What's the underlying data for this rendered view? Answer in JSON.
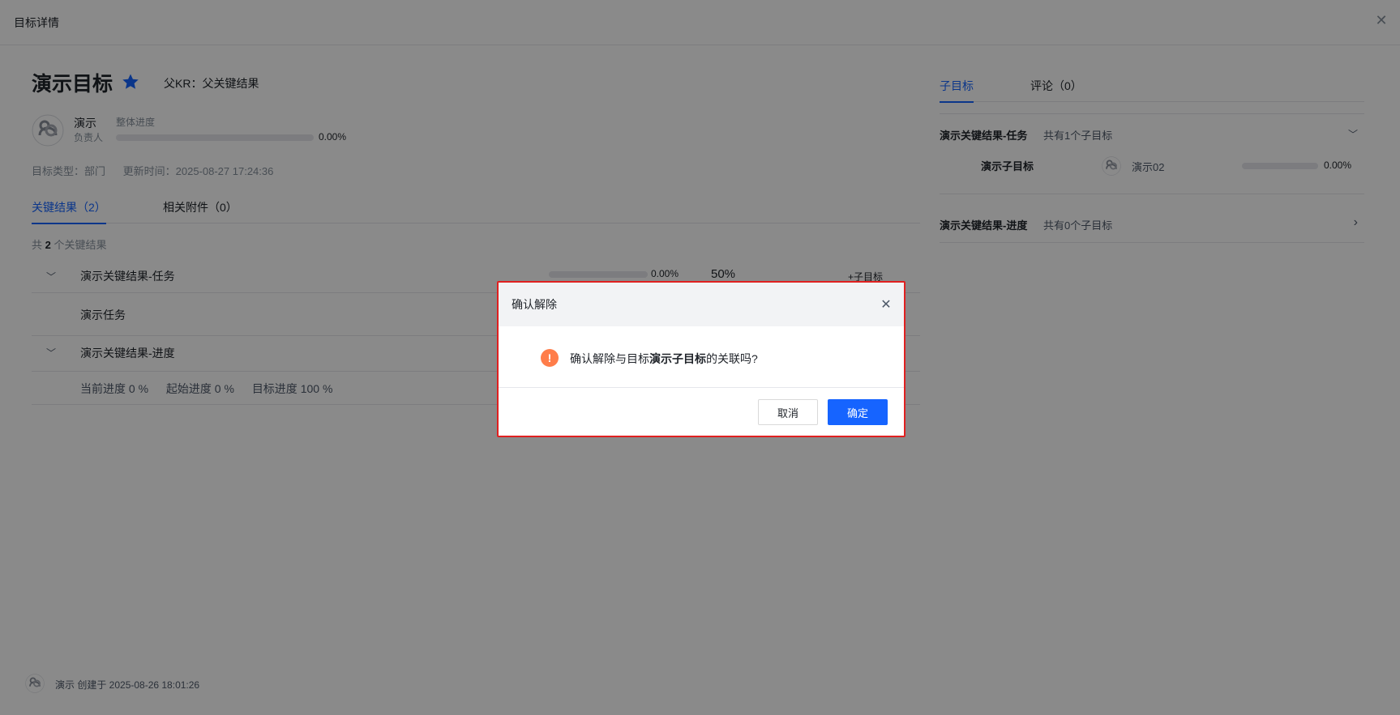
{
  "panel": {
    "title": "目标详情"
  },
  "goal": {
    "title": "演示目标",
    "parent_kr": "父KR：父关键结果",
    "owner_name": "演示",
    "owner_role": "负责人",
    "overall_progress_label": "整体进度",
    "overall_progress_value": "0.00%",
    "overall_progress": 0,
    "type_label": "目标类型：部门",
    "updated_label": "更新时间：2025-08-27 17:24:36"
  },
  "tabs": [
    "关键结果（2）",
    "相关附件（0）"
  ],
  "kr_count": {
    "prefix": "共",
    "count": "2",
    "suffix": "个关键结果"
  },
  "key_results": [
    {
      "name": "演示关键结果-任务",
      "progress_value": "0.00%",
      "progress": 0,
      "weight": "50%",
      "add_child": "+子目标"
    },
    {
      "name": "演示关键结果-进度"
    }
  ],
  "task_item": "演示任务",
  "kr2_progress": {
    "current": "当前进度  0 %",
    "start": "起始进度  0 %",
    "target": "目标进度  100 %"
  },
  "right_tabs": [
    "子目标",
    "评论（0）"
  ],
  "sub_groups": [
    {
      "name": "演示关键结果-任务",
      "count": "共有1个子目标",
      "expanded": true
    },
    {
      "name": "演示关键结果-进度",
      "count": "共有0个子目标",
      "expanded": false
    }
  ],
  "child_goal": {
    "name": "演示子目标",
    "owner": "演示02",
    "progress_value": "0.00%",
    "progress": 0
  },
  "footer": {
    "created": "演示 创建于 2025-08-26 18:01:26"
  },
  "dialog": {
    "title": "确认解除",
    "msg_prefix": "确认解除与目标",
    "msg_target": "演示子目标",
    "msg_suffix": "的关联吗?",
    "cancel": "取消",
    "confirm": "确定"
  },
  "colors": {
    "accent": "#1664ff",
    "warning": "#ff7d4a",
    "highlight_border": "#e02020"
  }
}
